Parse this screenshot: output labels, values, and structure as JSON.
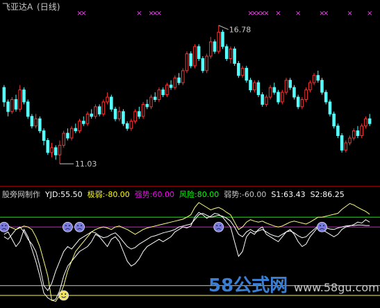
{
  "header": {
    "title": "飞亚达A",
    "period": "(日线)"
  },
  "price_panel": {
    "high_label": "16.78",
    "low_label": "11.03",
    "signal_marker": "×"
  },
  "indicator_panel": {
    "name": "股旁网制作",
    "items": [
      {
        "label": "YJD:55.50",
        "color": "#ffffff"
      },
      {
        "label": "极弱:-80.00",
        "color": "#ffff00"
      },
      {
        "label": "强势:60.00",
        "color": "#ff00ff"
      },
      {
        "label": "风险:80.00",
        "color": "#00ff00"
      },
      {
        "label": "弱势:-60.00",
        "color": "#c8c8c8"
      },
      {
        "label": "S1:63.43",
        "color": "#ffffff"
      },
      {
        "label": "S2:86.25",
        "color": "#ffffff"
      }
    ]
  },
  "watermark": {
    "brand": "58公式网",
    "url": "www.58gu.com"
  },
  "chart_data": {
    "type": "candlestick",
    "price": {
      "ylim": [
        10.4,
        17.2
      ],
      "high_value": 16.78,
      "low_value": 11.03,
      "candles": [
        [
          14.2,
          13.6,
          14.3,
          13.4
        ],
        [
          13.6,
          13.2,
          13.7,
          13.0
        ],
        [
          13.2,
          13.7,
          13.8,
          13.1
        ],
        [
          13.7,
          13.3,
          13.9,
          13.2
        ],
        [
          13.3,
          14.1,
          14.3,
          13.2
        ],
        [
          14.1,
          13.6,
          14.2,
          13.5
        ],
        [
          13.6,
          13.0,
          13.7,
          12.9
        ],
        [
          13.0,
          12.6,
          13.1,
          12.5
        ],
        [
          12.6,
          12.9,
          13.1,
          12.5
        ],
        [
          12.9,
          12.4,
          13.0,
          12.3
        ],
        [
          12.4,
          12.0,
          12.5,
          11.8
        ],
        [
          12.0,
          11.5,
          12.1,
          11.4
        ],
        [
          11.5,
          11.7,
          11.9,
          11.3
        ],
        [
          11.7,
          11.4,
          11.8,
          11.2
        ],
        [
          11.4,
          11.8,
          12.0,
          11.03
        ],
        [
          11.8,
          12.3,
          12.4,
          11.7
        ],
        [
          12.3,
          12.1,
          12.5,
          12.0
        ],
        [
          12.1,
          12.5,
          12.6,
          12.0
        ],
        [
          12.5,
          12.4,
          12.7,
          12.3
        ],
        [
          12.4,
          12.8,
          12.9,
          12.3
        ],
        [
          12.8,
          12.7,
          13.0,
          12.6
        ],
        [
          12.7,
          13.1,
          13.2,
          12.6
        ],
        [
          13.1,
          13.0,
          13.3,
          12.9
        ],
        [
          13.0,
          13.4,
          13.5,
          12.9
        ],
        [
          13.4,
          13.1,
          13.5,
          13.0
        ],
        [
          13.1,
          13.6,
          13.7,
          13.0
        ],
        [
          13.6,
          13.8,
          14.0,
          13.5
        ],
        [
          13.8,
          13.3,
          13.9,
          13.2
        ],
        [
          13.3,
          12.9,
          13.4,
          12.8
        ],
        [
          12.9,
          13.2,
          13.4,
          12.8
        ],
        [
          13.2,
          12.7,
          13.3,
          12.6
        ],
        [
          12.7,
          12.5,
          12.8,
          12.4
        ],
        [
          12.5,
          12.8,
          12.9,
          12.4
        ],
        [
          12.8,
          13.2,
          13.3,
          12.7
        ],
        [
          13.2,
          13.0,
          13.4,
          12.9
        ],
        [
          13.0,
          13.5,
          13.6,
          12.9
        ],
        [
          13.5,
          13.4,
          13.7,
          13.3
        ],
        [
          13.4,
          13.8,
          13.9,
          13.3
        ],
        [
          13.8,
          13.7,
          14.0,
          13.6
        ],
        [
          13.7,
          14.1,
          14.2,
          13.6
        ],
        [
          14.1,
          13.9,
          14.2,
          13.8
        ],
        [
          13.9,
          14.3,
          14.4,
          13.8
        ],
        [
          14.3,
          14.2,
          14.5,
          14.1
        ],
        [
          14.2,
          14.6,
          14.7,
          14.1
        ],
        [
          14.6,
          14.4,
          14.8,
          14.3
        ],
        [
          14.4,
          14.9,
          15.0,
          14.3
        ],
        [
          14.9,
          15.6,
          15.7,
          14.8
        ],
        [
          15.6,
          15.1,
          15.7,
          15.0
        ],
        [
          15.1,
          15.9,
          16.0,
          15.0
        ],
        [
          15.9,
          15.4,
          16.0,
          15.3
        ],
        [
          15.4,
          14.9,
          15.5,
          14.8
        ],
        [
          14.9,
          15.5,
          15.6,
          14.8
        ],
        [
          15.5,
          16.1,
          16.3,
          15.4
        ],
        [
          16.1,
          15.7,
          16.2,
          15.6
        ],
        [
          15.7,
          16.5,
          16.78,
          15.6
        ],
        [
          16.5,
          15.9,
          16.6,
          15.8
        ],
        [
          15.9,
          15.4,
          16.0,
          15.3
        ],
        [
          15.4,
          15.8,
          15.9,
          15.2
        ],
        [
          15.8,
          15.2,
          15.9,
          15.1
        ],
        [
          15.2,
          14.7,
          15.3,
          14.6
        ],
        [
          14.7,
          15.0,
          15.1,
          14.6
        ],
        [
          15.0,
          14.5,
          15.1,
          14.4
        ],
        [
          14.5,
          14.1,
          14.6,
          14.0
        ],
        [
          14.1,
          14.4,
          14.5,
          14.0
        ],
        [
          14.4,
          13.9,
          14.5,
          13.8
        ],
        [
          13.9,
          13.5,
          14.0,
          13.4
        ],
        [
          13.5,
          13.8,
          13.9,
          13.4
        ],
        [
          13.8,
          14.2,
          14.3,
          13.7
        ],
        [
          14.2,
          14.0,
          14.4,
          13.9
        ],
        [
          14.0,
          13.6,
          14.1,
          13.5
        ],
        [
          13.6,
          14.0,
          14.1,
          13.5
        ],
        [
          14.0,
          14.5,
          14.6,
          13.9
        ],
        [
          14.5,
          14.2,
          14.6,
          14.1
        ],
        [
          14.2,
          13.8,
          14.3,
          13.7
        ],
        [
          13.8,
          13.4,
          13.9,
          13.3
        ],
        [
          13.4,
          13.7,
          13.8,
          13.3
        ],
        [
          13.7,
          14.1,
          14.2,
          13.6
        ],
        [
          14.1,
          14.4,
          14.5,
          14.0
        ],
        [
          14.4,
          14.7,
          14.8,
          14.3
        ],
        [
          14.7,
          14.5,
          14.9,
          14.4
        ],
        [
          14.5,
          14.0,
          14.6,
          13.9
        ],
        [
          14.0,
          13.6,
          14.1,
          13.5
        ],
        [
          13.6,
          13.1,
          13.7,
          13.0
        ],
        [
          13.1,
          12.6,
          13.2,
          12.5
        ],
        [
          12.6,
          12.2,
          12.7,
          12.1
        ],
        [
          12.2,
          11.6,
          12.3,
          11.5
        ],
        [
          11.6,
          11.9,
          12.0,
          11.5
        ],
        [
          11.9,
          12.1,
          12.2,
          11.8
        ],
        [
          12.1,
          12.4,
          12.5,
          12.0
        ],
        [
          12.4,
          12.2,
          12.6,
          12.1
        ],
        [
          12.2,
          12.6,
          12.7,
          12.1
        ],
        [
          12.6,
          12.9,
          13.0,
          12.5
        ],
        [
          12.9,
          12.7,
          13.1,
          12.6
        ]
      ]
    },
    "signals": [
      19,
      20,
      34,
      37,
      38,
      39,
      62,
      63,
      64,
      65,
      66,
      69,
      74,
      80,
      81,
      87,
      92
    ],
    "indicator": {
      "ylim": [
        -100,
        110
      ],
      "reference_lines": [
        {
          "name": "风险",
          "value": 80,
          "color": "#00ff00"
        },
        {
          "name": "强势",
          "value": 60,
          "color": "#ff00ff"
        },
        {
          "name": "弱势",
          "value": -60,
          "color": "#c8c8c8"
        },
        {
          "name": "极弱",
          "value": -80,
          "color": "#ffff00"
        }
      ],
      "series": [
        {
          "name": "YJD",
          "color": "#ffffff",
          "values": [
            45,
            50,
            35,
            20,
            30,
            55,
            40,
            15,
            -10,
            -40,
            -75,
            -85,
            -90,
            -88,
            -70,
            -40,
            -20,
            -10,
            0,
            10,
            15,
            20,
            30,
            45,
            40,
            30,
            20,
            35,
            40,
            30,
            10,
            -10,
            -20,
            -15,
            -5,
            10,
            20,
            25,
            30,
            35,
            30,
            35,
            40,
            50,
            55,
            60,
            58,
            62,
            80,
            90,
            85,
            78,
            82,
            88,
            86,
            80,
            70,
            60,
            30,
            0,
            10,
            40,
            50,
            45,
            55,
            60,
            45,
            40,
            35,
            30,
            40,
            50,
            55,
            45,
            30,
            20,
            25,
            40,
            50,
            60,
            55,
            50,
            45,
            40,
            45,
            55,
            60,
            62,
            65,
            70,
            68,
            75,
            70
          ]
        },
        {
          "name": "S1",
          "color": "#ffffff",
          "values": [
            40,
            35,
            45,
            55,
            60,
            50,
            35,
            25,
            10,
            -20,
            -60,
            -70,
            -55,
            -30,
            -10,
            10,
            20,
            15,
            25,
            35,
            40,
            45,
            50,
            48,
            42,
            38,
            40,
            45,
            48,
            40,
            30,
            20,
            15,
            18,
            25,
            30,
            35,
            40,
            42,
            45,
            48,
            50,
            52,
            55,
            60,
            62,
            64,
            66,
            75,
            85,
            88,
            84,
            80,
            82,
            84,
            82,
            78,
            72,
            60,
            45,
            40,
            50,
            55,
            50,
            52,
            55,
            50,
            45,
            42,
            40,
            45,
            50,
            52,
            48,
            42,
            38,
            40,
            48,
            55,
            62,
            60,
            58,
            56,
            55,
            58,
            60,
            62,
            63,
            63,
            64,
            64,
            63,
            63
          ]
        },
        {
          "name": "S2",
          "color": "#ffff80",
          "values": [
            60,
            62,
            58,
            55,
            58,
            62,
            60,
            55,
            40,
            20,
            -10,
            -40,
            -90,
            -92,
            -80,
            -60,
            -30,
            -10,
            10,
            20,
            30,
            40,
            50,
            55,
            58,
            60,
            58,
            55,
            60,
            62,
            58,
            55,
            50,
            45,
            50,
            55,
            58,
            60,
            62,
            64,
            66,
            68,
            70,
            72,
            74,
            76,
            80,
            85,
            100,
            110,
            105,
            100,
            95,
            98,
            100,
            96,
            90,
            85,
            70,
            55,
            60,
            70,
            75,
            72,
            70,
            72,
            68,
            65,
            62,
            60,
            62,
            66,
            70,
            72,
            70,
            68,
            66,
            70,
            75,
            80,
            80,
            82,
            84,
            86,
            88,
            96,
            102,
            108,
            105,
            100,
            96,
            92,
            86
          ]
        }
      ],
      "face_markers": {
        "weak": [
          0,
          16,
          19,
          54,
          80
        ],
        "smile": [
          15
        ]
      }
    }
  }
}
